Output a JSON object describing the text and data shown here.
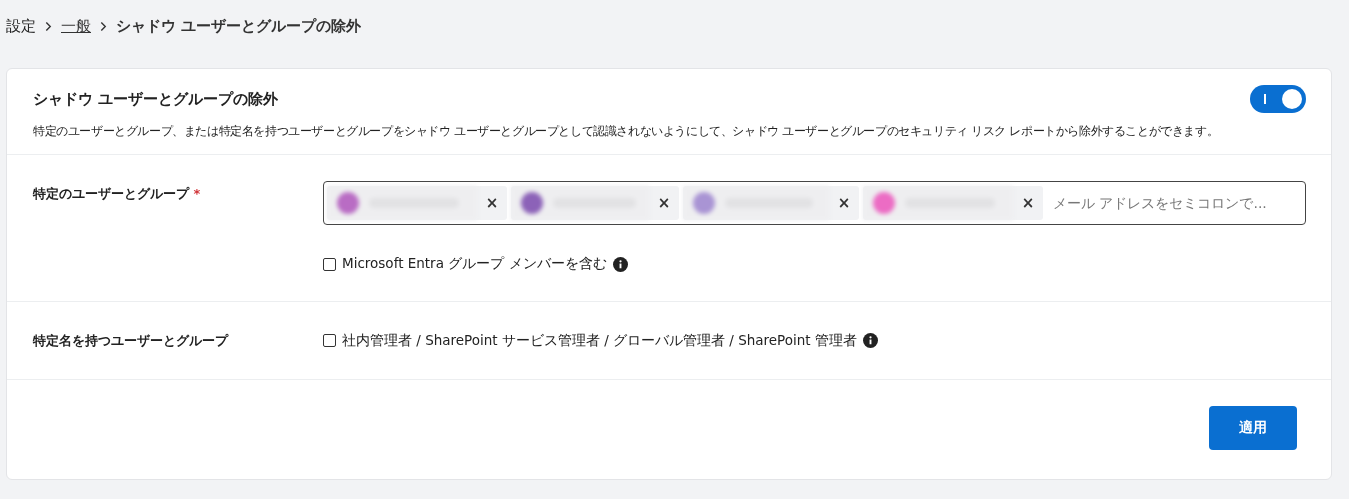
{
  "breadcrumb": [
    {
      "label": "設定",
      "kind": "text"
    },
    {
      "label": "一般",
      "kind": "link"
    },
    {
      "label": "シャドウ ユーザーとグループの除外",
      "kind": "current"
    }
  ],
  "card": {
    "title": "シャドウ ユーザーとグループの除外",
    "toggle": {
      "on": true
    },
    "description": "特定のユーザーとグループ、または特定名を持つユーザーとグループをシャドウ ユーザーとグループとして認識されないようにして、シャドウ ユーザーとグループのセキュリティ リスク レポートから除外することができます。"
  },
  "specific": {
    "label": "特定のユーザーとグループ",
    "required_mark": "*",
    "chips": [
      {
        "color": "#b96cc4",
        "remove": "×"
      },
      {
        "color": "#8c62b8",
        "remove": "×"
      },
      {
        "color": "#a994d4",
        "remove": "×"
      },
      {
        "color": "#ec6cc4",
        "remove": "×"
      }
    ],
    "placeholder": "メール アドレスをセミコロンで...",
    "checkbox": {
      "label": "Microsoft Entra グループ メンバーを含む",
      "checked": false
    }
  },
  "named": {
    "label": "特定名を持つユーザーとグループ",
    "checkbox": {
      "label": "社内管理者 / SharePoint サービス管理者 / グローバル管理者 / SharePoint 管理者",
      "checked": false
    }
  },
  "apply_button": "適用"
}
